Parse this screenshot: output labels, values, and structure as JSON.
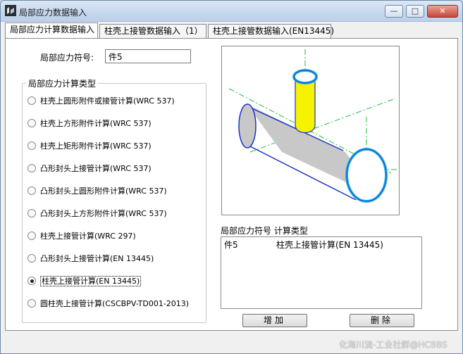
{
  "window": {
    "title": "局部应力数据输入",
    "controls": {
      "minimize": "—",
      "maximize": "□",
      "close": "✕"
    }
  },
  "tabs": [
    {
      "label": "局部应力计算数据输入",
      "active": true
    },
    {
      "label": "柱壳上接管数据输入（1）",
      "active": false
    },
    {
      "label": "柱壳上接管数据输入(EN13445)",
      "active": false
    }
  ],
  "symbol": {
    "label": "局部应力符号:",
    "value": "件5"
  },
  "calc_type": {
    "title": "局部应力计算类型",
    "options": [
      "柱壳上圆形附件或接管计算(WRC 537)",
      "柱壳上方形附件计算(WRC 537)",
      "柱壳上矩形附件计算(WRC 537)",
      "凸形封头上接管计算(WRC 537)",
      "凸形封头上圆形附件计算(WRC 537)",
      "凸形封头上方形附件计算(WRC 537)",
      "柱壳上接管计算(WRC 297)",
      "凸形封头上接管计算(EN 13445)",
      "柱壳上接管计算(EN 13445)",
      "圆柱壳上接管计算(CSCBPV-TD001-2013)"
    ],
    "selected_index": 8
  },
  "list": {
    "header": "局部应力符号  计算类型",
    "rows": [
      {
        "symbol": "件5",
        "type": "柱壳上接管计算(EN 13445)"
      }
    ]
  },
  "buttons": {
    "add": "增加",
    "delete": "删除"
  },
  "watermark": "化海川流-工业社群@HCBBS",
  "colors": {
    "nozzle": "#f5f300",
    "shell": "#c8c8c8",
    "outline": "#1a34c8",
    "rim": "#25b7e8",
    "centerline": "#1bbf3a"
  }
}
